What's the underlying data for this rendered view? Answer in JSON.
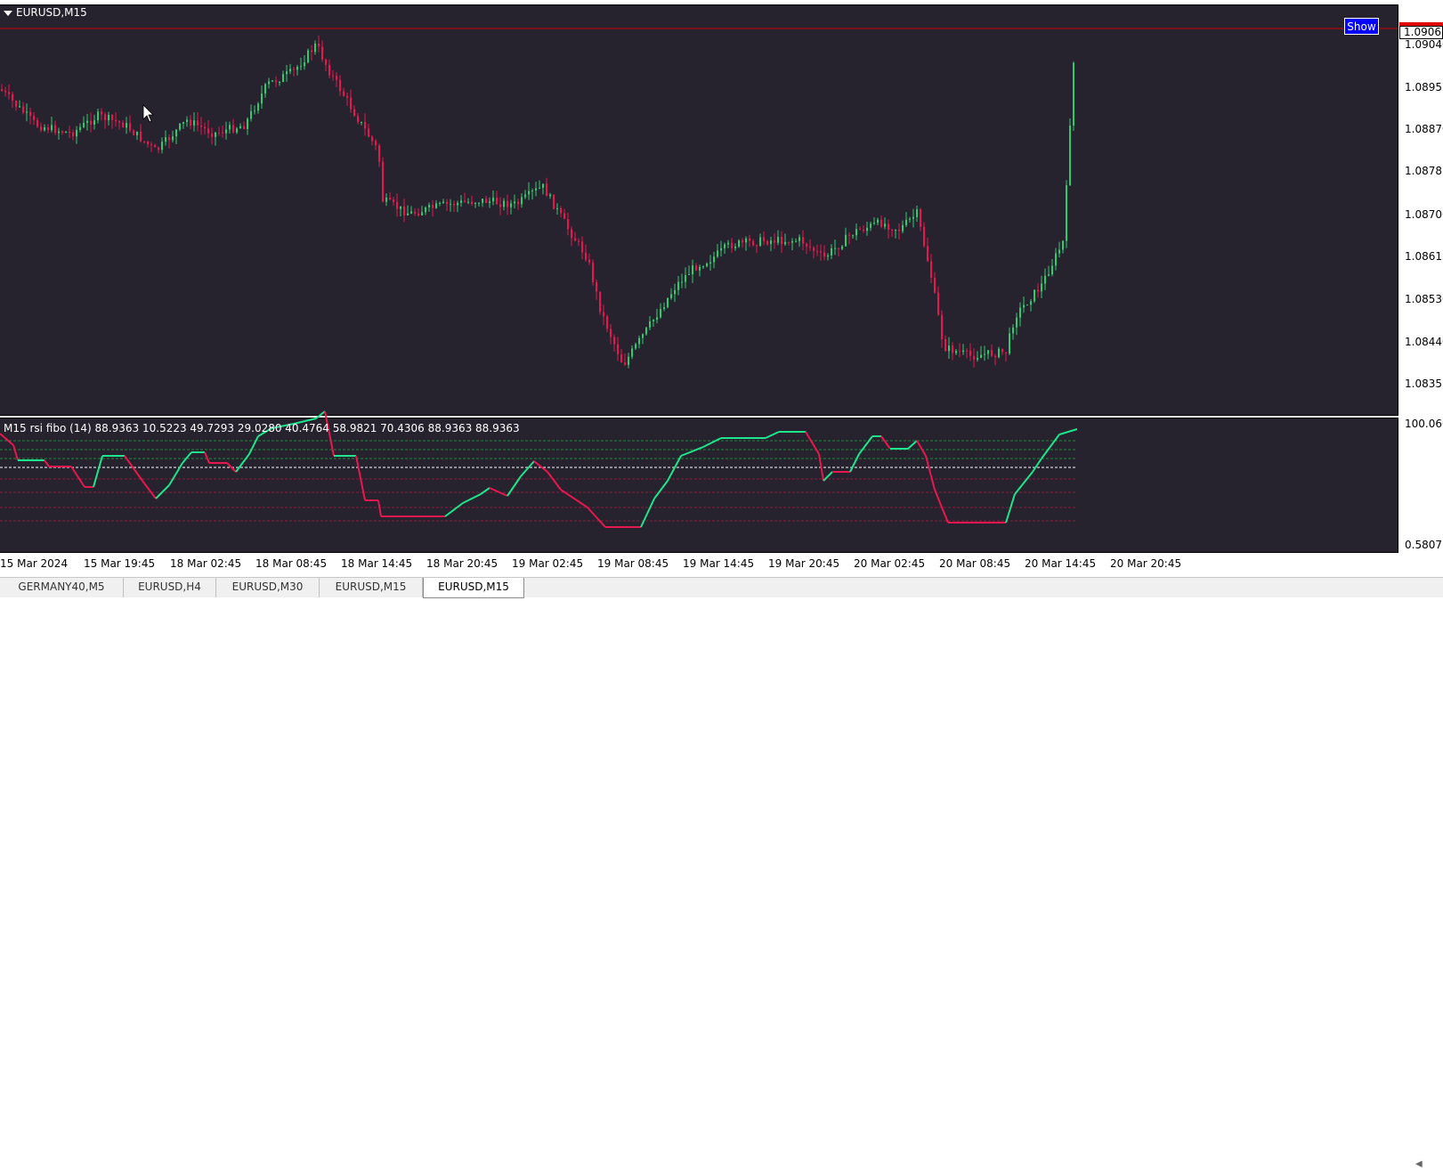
{
  "window": {
    "title": "EURUSD,M15"
  },
  "chart": {
    "show_button_label": "Show",
    "bid_price": "1.09065",
    "price_scale": [
      "1.09040",
      "1.08955",
      "1.08870",
      "1.08785",
      "1.08700",
      "1.08615",
      "1.08530",
      "1.08440",
      "1.08355"
    ],
    "time_scale": [
      "15 Mar 2024",
      "15 Mar 19:45",
      "18 Mar 02:45",
      "18 Mar 08:45",
      "18 Mar 14:45",
      "18 Mar 20:45",
      "19 Mar 02:45",
      "19 Mar 08:45",
      "19 Mar 14:45",
      "19 Mar 20:45",
      "20 Mar 02:45",
      "20 Mar 08:45",
      "20 Mar 14:45",
      "20 Mar 20:45"
    ],
    "colors": {
      "background": "#26222e",
      "bull_candle": "#2ecc71",
      "bear_candle": "#e8174f",
      "bid_line": "#d00000",
      "rsi_up": "#1ee68c",
      "rsi_down": "#e8174f",
      "rsi_neutral": "#909090"
    }
  },
  "indicator": {
    "label": "M15 rsi fibo (14) 88.9363 10.5223 49.7293 29.0280 40.4764 58.9821 70.4306 88.9363 88.9363",
    "scale_max": "100.0601",
    "scale_min": "0.5807"
  },
  "tabs": [
    {
      "label": "GERMANY40,M5",
      "active": false
    },
    {
      "label": "EURUSD,H4",
      "active": false
    },
    {
      "label": "EURUSD,M30",
      "active": false
    },
    {
      "label": "EURUSD,M15",
      "active": false
    },
    {
      "label": "EURUSD,M15",
      "active": true
    }
  ]
}
